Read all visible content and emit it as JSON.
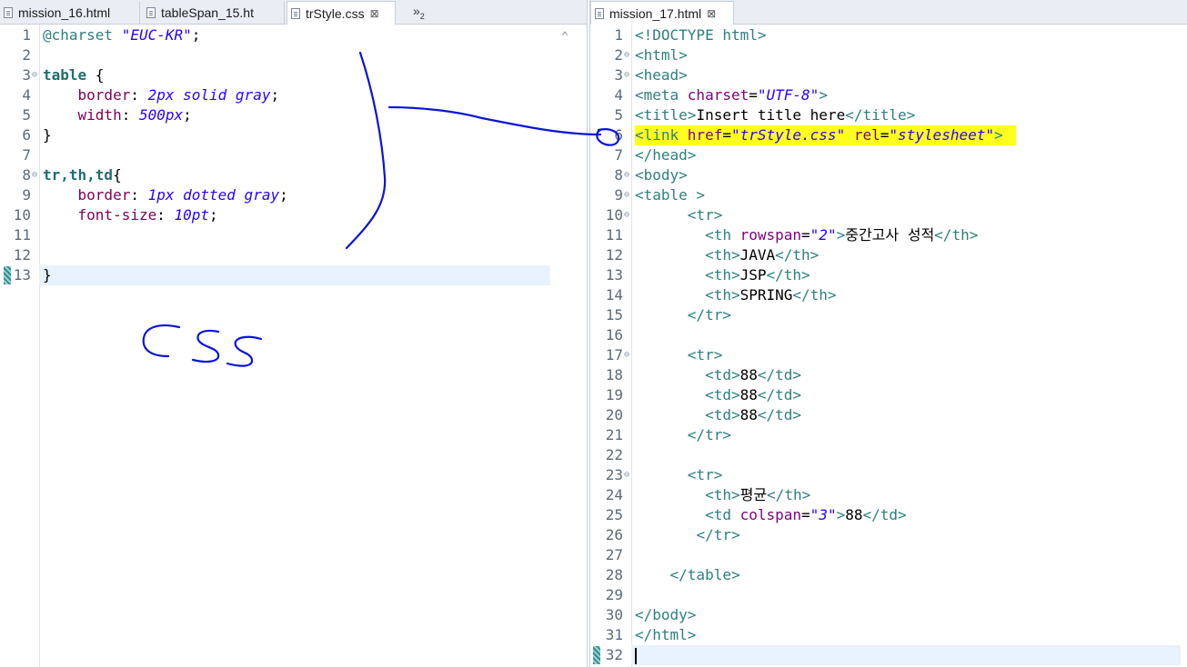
{
  "left_tabs": [
    {
      "label": "mission_16.html"
    },
    {
      "label": "tableSpan_15.ht"
    },
    {
      "label": "trStyle.css",
      "close": "⊠"
    }
  ],
  "overflow": {
    "glyph": "»",
    "count": "2"
  },
  "right_tabs": [
    {
      "label": "mission_17.html",
      "close": "⊠"
    }
  ],
  "css_file": {
    "lines": [
      {
        "n": "1",
        "parts": [
          [
            "c-teal",
            "@charset "
          ],
          [
            "c-str",
            "\"EUC-KR\""
          ],
          [
            "c-punct",
            ";"
          ]
        ]
      },
      {
        "n": "2",
        "parts": []
      },
      {
        "n": "3",
        "fold": "⊖",
        "parts": [
          [
            "c-kw",
            "table"
          ],
          [
            "c-punct",
            " {"
          ]
        ]
      },
      {
        "n": "4",
        "parts": [
          [
            "c-prop",
            "    border"
          ],
          [
            "c-punct",
            ": "
          ],
          [
            "c-val",
            "2px solid gray"
          ],
          [
            "c-punct",
            ";"
          ]
        ]
      },
      {
        "n": "5",
        "parts": [
          [
            "c-prop",
            "    width"
          ],
          [
            "c-punct",
            ": "
          ],
          [
            "c-val",
            "500px"
          ],
          [
            "c-punct",
            ";"
          ]
        ]
      },
      {
        "n": "6",
        "parts": [
          [
            "c-punct",
            "}"
          ]
        ]
      },
      {
        "n": "7",
        "parts": []
      },
      {
        "n": "8",
        "fold": "⊖",
        "parts": [
          [
            "c-kw",
            "tr,th,td"
          ],
          [
            "c-punct",
            "{"
          ]
        ]
      },
      {
        "n": "9",
        "parts": [
          [
            "c-prop",
            "    border"
          ],
          [
            "c-punct",
            ": "
          ],
          [
            "c-val",
            "1px dotted gray"
          ],
          [
            "c-punct",
            ";"
          ]
        ]
      },
      {
        "n": "10",
        "parts": [
          [
            "c-prop",
            "    font-size"
          ],
          [
            "c-punct",
            ": "
          ],
          [
            "c-val",
            "10pt"
          ],
          [
            "c-punct",
            ";"
          ]
        ]
      },
      {
        "n": "11",
        "parts": []
      },
      {
        "n": "12",
        "parts": []
      },
      {
        "n": "13",
        "current": true,
        "parts": [
          [
            "c-punct",
            "}"
          ]
        ]
      }
    ]
  },
  "html_file": {
    "lines": [
      {
        "n": "1",
        "parts": [
          [
            "c-teal",
            "<!DOCTYPE "
          ],
          [
            "c-teal",
            "html"
          ],
          [
            "c-teal",
            ">"
          ]
        ]
      },
      {
        "n": "2",
        "fold": "⊖",
        "parts": [
          [
            "c-teal",
            "<html>"
          ]
        ]
      },
      {
        "n": "3",
        "fold": "⊖",
        "parts": [
          [
            "c-teal",
            "<head>"
          ]
        ]
      },
      {
        "n": "4",
        "parts": [
          [
            "c-teal",
            "<meta "
          ],
          [
            "c-attr",
            "charset"
          ],
          [
            "c-punct",
            "="
          ],
          [
            "c-str",
            "\"UTF-8\""
          ],
          [
            "c-teal",
            ">"
          ]
        ]
      },
      {
        "n": "5",
        "parts": [
          [
            "c-teal",
            "<title>"
          ],
          [
            "c-text",
            "Insert title here"
          ],
          [
            "c-teal",
            "</title>"
          ]
        ]
      },
      {
        "n": "6",
        "highlight": true,
        "parts": [
          [
            "c-teal",
            "<link "
          ],
          [
            "c-attr",
            "href"
          ],
          [
            "c-punct",
            "="
          ],
          [
            "c-str",
            "\"trStyle.css\""
          ],
          [
            "c-text",
            " "
          ],
          [
            "c-attr",
            "rel"
          ],
          [
            "c-punct",
            "="
          ],
          [
            "c-str",
            "\"stylesheet\""
          ],
          [
            "c-teal",
            ">"
          ]
        ]
      },
      {
        "n": "7",
        "parts": [
          [
            "c-teal",
            "</head>"
          ]
        ]
      },
      {
        "n": "8",
        "fold": "⊖",
        "parts": [
          [
            "c-teal",
            "<body>"
          ]
        ]
      },
      {
        "n": "9",
        "fold": "⊖",
        "parts": [
          [
            "c-teal",
            "<table >"
          ]
        ]
      },
      {
        "n": "10",
        "fold": "⊖",
        "parts": [
          [
            "c-text",
            "      "
          ],
          [
            "c-teal",
            "<tr>"
          ]
        ]
      },
      {
        "n": "11",
        "parts": [
          [
            "c-text",
            "        "
          ],
          [
            "c-teal",
            "<th "
          ],
          [
            "c-attr",
            "rowspan"
          ],
          [
            "c-punct",
            "="
          ],
          [
            "c-str",
            "\"2\""
          ],
          [
            "c-teal",
            ">"
          ],
          [
            "c-text",
            "중간고사 성적"
          ],
          [
            "c-teal",
            "</th>"
          ]
        ]
      },
      {
        "n": "12",
        "parts": [
          [
            "c-text",
            "        "
          ],
          [
            "c-teal",
            "<th>"
          ],
          [
            "c-text",
            "JAVA"
          ],
          [
            "c-teal",
            "</th>"
          ]
        ]
      },
      {
        "n": "13",
        "parts": [
          [
            "c-text",
            "        "
          ],
          [
            "c-teal",
            "<th>"
          ],
          [
            "c-text",
            "JSP"
          ],
          [
            "c-teal",
            "</th>"
          ]
        ]
      },
      {
        "n": "14",
        "parts": [
          [
            "c-text",
            "        "
          ],
          [
            "c-teal",
            "<th>"
          ],
          [
            "c-text",
            "SPRING"
          ],
          [
            "c-teal",
            "</th>"
          ]
        ]
      },
      {
        "n": "15",
        "parts": [
          [
            "c-text",
            "      "
          ],
          [
            "c-teal",
            "</tr>"
          ]
        ]
      },
      {
        "n": "16",
        "parts": []
      },
      {
        "n": "17",
        "fold": "⊖",
        "parts": [
          [
            "c-text",
            "      "
          ],
          [
            "c-teal",
            "<tr>"
          ]
        ]
      },
      {
        "n": "18",
        "parts": [
          [
            "c-text",
            "        "
          ],
          [
            "c-teal",
            "<td>"
          ],
          [
            "c-text",
            "88"
          ],
          [
            "c-teal",
            "</td>"
          ]
        ]
      },
      {
        "n": "19",
        "parts": [
          [
            "c-text",
            "        "
          ],
          [
            "c-teal",
            "<td>"
          ],
          [
            "c-text",
            "88"
          ],
          [
            "c-teal",
            "</td>"
          ]
        ]
      },
      {
        "n": "20",
        "parts": [
          [
            "c-text",
            "        "
          ],
          [
            "c-teal",
            "<td>"
          ],
          [
            "c-text",
            "88"
          ],
          [
            "c-teal",
            "</td>"
          ]
        ]
      },
      {
        "n": "21",
        "parts": [
          [
            "c-text",
            "      "
          ],
          [
            "c-teal",
            "</tr>"
          ]
        ]
      },
      {
        "n": "22",
        "parts": []
      },
      {
        "n": "23",
        "fold": "⊖",
        "parts": [
          [
            "c-text",
            "      "
          ],
          [
            "c-teal",
            "<tr>"
          ]
        ]
      },
      {
        "n": "24",
        "parts": [
          [
            "c-text",
            "        "
          ],
          [
            "c-teal",
            "<th>"
          ],
          [
            "c-text",
            "평균"
          ],
          [
            "c-teal",
            "</th>"
          ]
        ]
      },
      {
        "n": "25",
        "parts": [
          [
            "c-text",
            "        "
          ],
          [
            "c-teal",
            "<td "
          ],
          [
            "c-attr",
            "colspan"
          ],
          [
            "c-punct",
            "="
          ],
          [
            "c-str",
            "\"3\""
          ],
          [
            "c-teal",
            ">"
          ],
          [
            "c-text",
            "88"
          ],
          [
            "c-teal",
            "</td>"
          ]
        ]
      },
      {
        "n": "26",
        "parts": [
          [
            "c-text",
            "       "
          ],
          [
            "c-teal",
            "</tr>"
          ]
        ]
      },
      {
        "n": "27",
        "parts": []
      },
      {
        "n": "28",
        "parts": [
          [
            "c-text",
            "    "
          ],
          [
            "c-teal",
            "</table>"
          ]
        ]
      },
      {
        "n": "29",
        "parts": []
      },
      {
        "n": "30",
        "parts": [
          [
            "c-teal",
            "</body>"
          ]
        ]
      },
      {
        "n": "31",
        "parts": [
          [
            "c-teal",
            "</html>"
          ]
        ]
      },
      {
        "n": "32",
        "current": true,
        "caret": true,
        "parts": []
      }
    ]
  },
  "annotation": {
    "text": "CSS",
    "ink_color": "#0a14d8"
  },
  "colors": {
    "highlight": "#ffff1e",
    "current_line": "#e8f2fe",
    "tab_bar": "#e9eef5"
  }
}
